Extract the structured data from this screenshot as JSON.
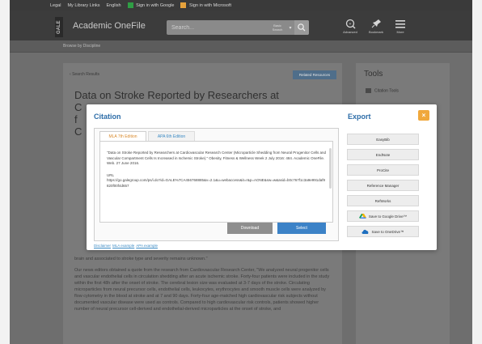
{
  "top_bar": {
    "links": [
      "Legal",
      "My Library Links",
      "English",
      "Sign in with Google",
      "Sign in with Microsoft"
    ]
  },
  "header": {
    "brand": "GALE",
    "product": "Academic OneFile",
    "search_placeholder": "Search...",
    "search_scope": "Basic Search",
    "actions": [
      {
        "label": "Advanced",
        "icon": "search-advanced-icon"
      },
      {
        "label": "Bookmark",
        "icon": "pin-icon"
      },
      {
        "label": "More",
        "icon": "menu-icon"
      }
    ]
  },
  "breadcrumb": "Browse by Discipline",
  "page": {
    "back_link": "Search Results",
    "related_button": "Related Resources",
    "title": "Data on Stroke Reported by Researchers at",
    "partial_fragments": [
      "C",
      "f",
      "C"
    ],
    "body_paragraphs": [
      "brain and associated to stroke type and severity remains unknown.\"",
      "Our news editors obtained a quote from the research from Cardiovascular Research Center, \"We analyzed neural progenitor cells and vascular endothelial cells in circulation shedding after an acute ischemic stroke. Forty-four patients were included in the study within the first 48h after the onset of stroke. The cerebral lesion size was evaluated at 3-7 days of the stroke. Circulating microparticles from neural precursor cells, endothelial cells, leukocytes, erythrocytes and smooth muscle cells were analyzed by flow cytometry in the blood at stroke and at 7 and 90 days. Forty-four age-matched high cardiovascular risk subjects without documented vascular disease were used as controls. Compared to high cardiovascular risk controls, patients showed higher number of neural precursor cell-derived and endothelial-derived microparticles at the onset of stroke, and"
    ]
  },
  "tools": {
    "title": "Tools",
    "first_item": "Citation Tools"
  },
  "modal": {
    "citation_heading": "Citation",
    "export_heading": "Export",
    "close_label": "×",
    "tabs": [
      {
        "label": "MLA 7th Edition",
        "active": true
      },
      {
        "label": "APA 6th Edition",
        "active": false
      }
    ],
    "citation_text": "\"Data on Stroke Reported by Researchers at Cardiovascular Research Center (Microparticle Shedding from Neural Progenitor Cells and Vascular Compartment Cells Is Increased in Ischemic Stroke).\" Obesity, Fitness & Wellness Week 2 July 2016: 484. Academic OneFile. Web. 27 June 2016.",
    "url_label": "URL",
    "url_value": "https://go.galegroup.com/ps/i.do?id=GALE%7CA456768885&v=2.1&u=webaccess&it=r&p=AONE&sw=w&asid=b0c767f1c3a9e991daf9820f00f4d657",
    "download_button": "Download",
    "select_button": "Select",
    "disclaimer_links": [
      "Disclaimer",
      "MLA example",
      "APA example"
    ],
    "export_buttons": [
      {
        "label": "EasyBib",
        "icon": ""
      },
      {
        "label": "EndNote",
        "icon": ""
      },
      {
        "label": "ProCite",
        "icon": ""
      },
      {
        "label": "Reference Manager",
        "icon": ""
      },
      {
        "label": "RefWorks",
        "icon": ""
      },
      {
        "label": "Save to Google Drive™",
        "icon": "google-drive-icon"
      },
      {
        "label": "Save to OneDrive™",
        "icon": "onedrive-icon"
      }
    ]
  },
  "colors": {
    "accent_blue": "#2d6da8",
    "select_blue": "#3c82c7",
    "close_orange": "#f0a83c",
    "tab_orange": "#d98a2c",
    "overlay_gray": "#6e6e6e"
  }
}
